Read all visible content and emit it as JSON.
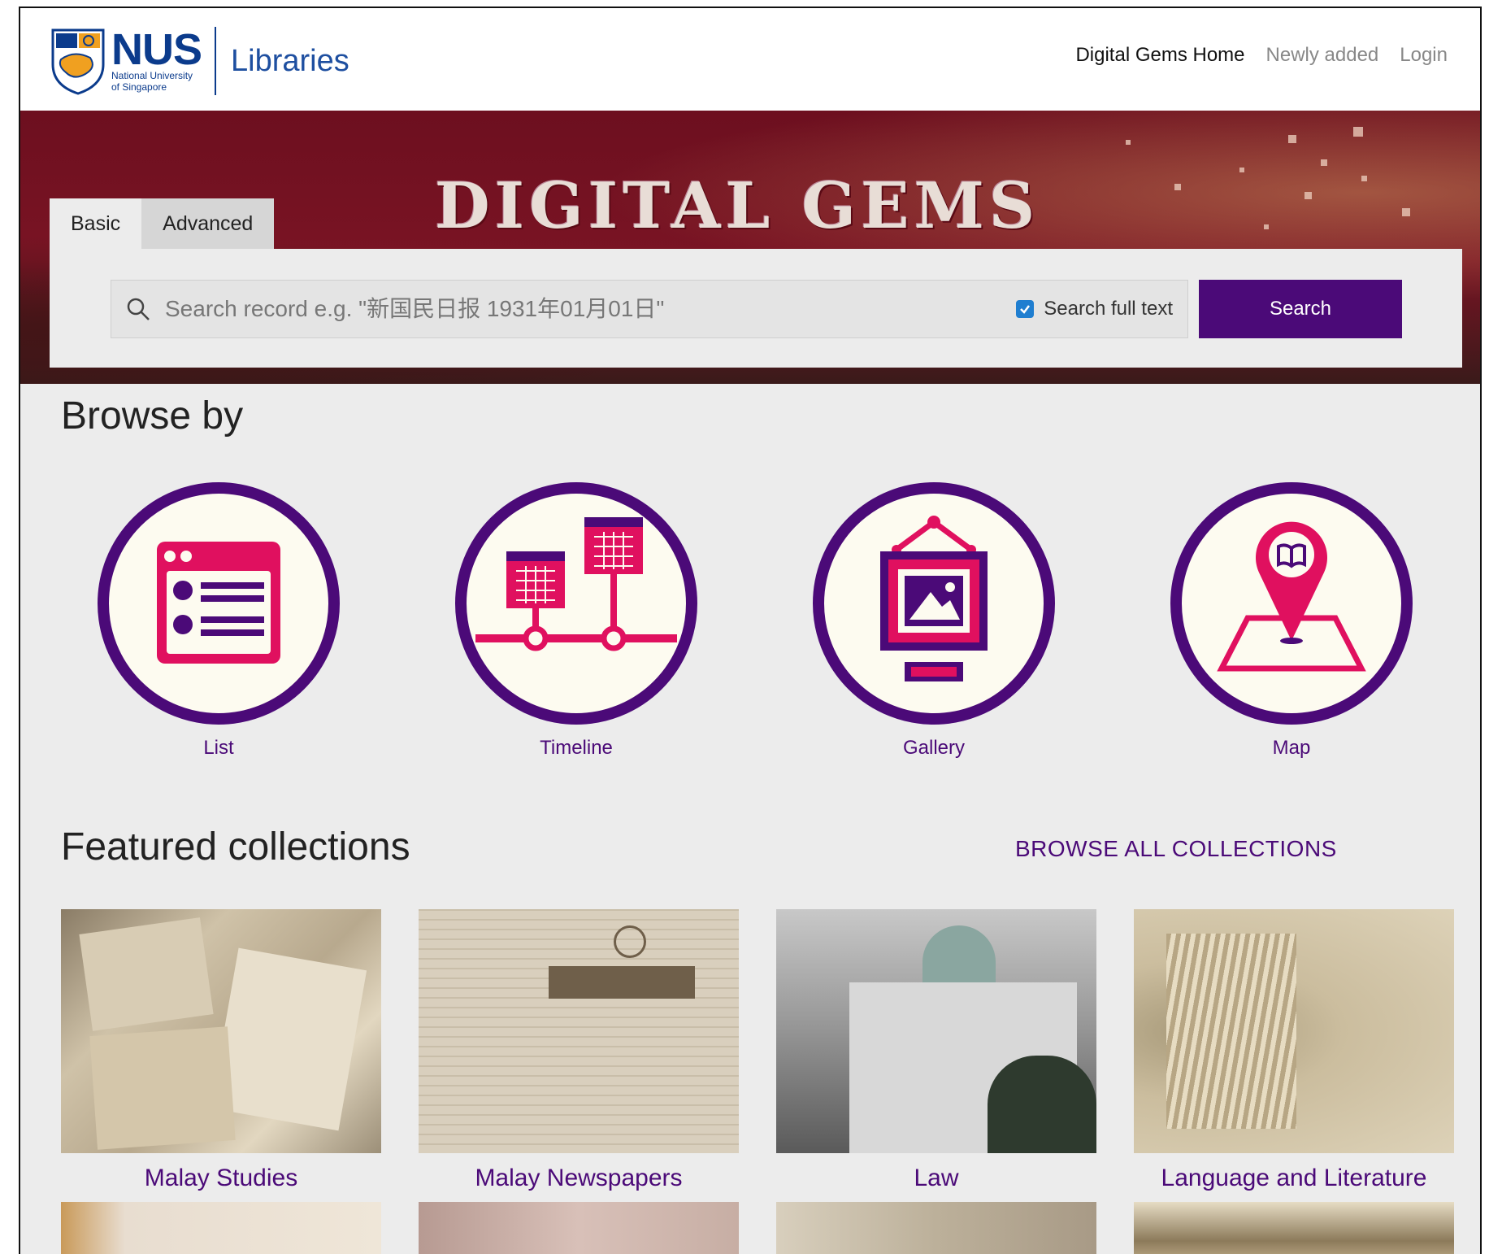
{
  "header": {
    "logo_text": "NUS",
    "logo_sub_line1": "National University",
    "logo_sub_line2": "of Singapore",
    "libraries": "Libraries",
    "nav": [
      {
        "label": "Digital Gems Home",
        "active": true
      },
      {
        "label": "Newly added",
        "active": false
      },
      {
        "label": "Login",
        "active": false
      }
    ]
  },
  "banner": {
    "title": "DIGITAL GEMS"
  },
  "search": {
    "tabs": [
      "Basic",
      "Advanced"
    ],
    "placeholder": "Search record e.g. \"新国民日报 1931年01月01日\"",
    "fulltext_label": "Search full text",
    "fulltext_checked": true,
    "button_label": "Search"
  },
  "browse": {
    "title": "Browse by",
    "items": [
      {
        "label": "List",
        "icon": "list-icon"
      },
      {
        "label": "Timeline",
        "icon": "timeline-icon"
      },
      {
        "label": "Gallery",
        "icon": "gallery-icon"
      },
      {
        "label": "Map",
        "icon": "map-icon"
      }
    ]
  },
  "featured": {
    "title": "Featured collections",
    "browse_all": "BROWSE ALL COLLECTIONS",
    "collections": [
      {
        "label": "Malay Studies"
      },
      {
        "label": "Malay Newspapers"
      },
      {
        "label": "Law"
      },
      {
        "label": "Language and Literature"
      }
    ]
  },
  "colors": {
    "accent_purple": "#4b0a78",
    "icon_pink": "#e0105f",
    "banner_red": "#7a1424",
    "nus_blue": "#0b3b8c"
  }
}
